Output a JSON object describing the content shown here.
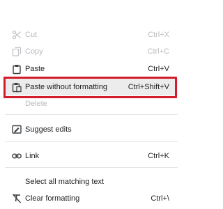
{
  "menu": {
    "items": [
      {
        "label": "Cut",
        "shortcut": "Ctrl+X",
        "icon": "scissors-icon",
        "disabled": true
      },
      {
        "label": "Copy",
        "shortcut": "Ctrl+C",
        "icon": "copy-icon",
        "disabled": true
      },
      {
        "label": "Paste",
        "shortcut": "Ctrl+V",
        "icon": "clipboard-icon",
        "disabled": false
      },
      {
        "label": "Paste without formatting",
        "shortcut": "Ctrl+Shift+V",
        "icon": "clipboard-plain-icon",
        "disabled": false
      },
      {
        "label": "Delete",
        "disabled": true
      },
      {
        "label": "Suggest edits",
        "icon": "suggest-edit-icon",
        "disabled": false
      },
      {
        "label": "Link",
        "shortcut": "Ctrl+K",
        "icon": "link-icon",
        "disabled": false
      },
      {
        "label": "Select all matching text",
        "disabled": false
      },
      {
        "label": "Clear formatting",
        "shortcut": "Ctrl+\\",
        "icon": "clear-format-icon",
        "disabled": false
      }
    ]
  },
  "colors": {
    "highlight_border": "#d21d2a",
    "text": "#202124",
    "disabled_text": "#b9bbbe"
  }
}
